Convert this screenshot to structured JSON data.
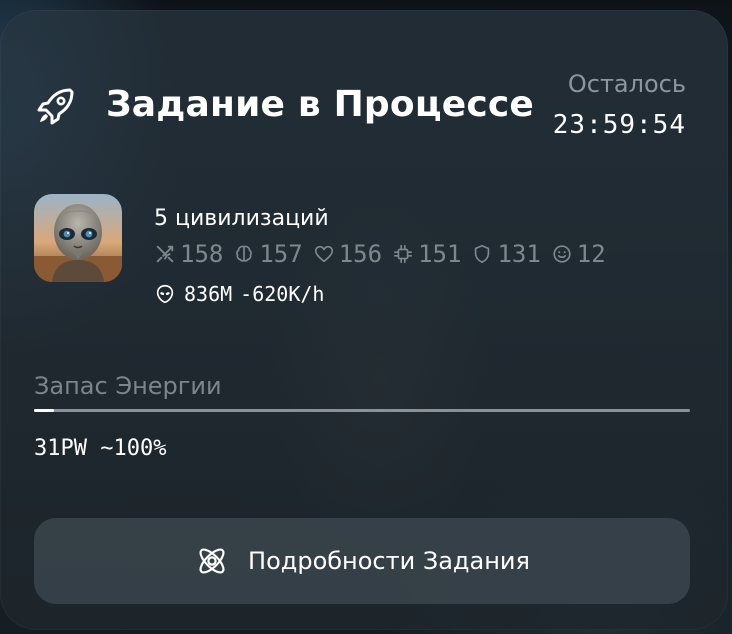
{
  "task": {
    "title": "Задание в Процессе",
    "remaining_label": "Осталось",
    "timer": "23:59:54"
  },
  "civilization": {
    "count_label": "5 цивилизаций",
    "stats": [
      {
        "icon": "swords-icon",
        "value": "158"
      },
      {
        "icon": "brain-icon",
        "value": "157"
      },
      {
        "icon": "heart-icon",
        "value": "156"
      },
      {
        "icon": "chip-icon",
        "value": "151"
      },
      {
        "icon": "shield-icon",
        "value": "131"
      },
      {
        "icon": "smile-icon",
        "value": "12"
      }
    ],
    "population": "836M",
    "rate": "-620K/h"
  },
  "energy": {
    "label": "Запас Энергии",
    "value_text": "31PW ~100%",
    "bar_fraction": 0.03
  },
  "details_button": {
    "label": "Подробности Задания",
    "icon": "atom-icon"
  },
  "colors": {
    "text_primary": "#ffffff",
    "text_muted": "#80878c",
    "button_bg": "#48565f"
  }
}
